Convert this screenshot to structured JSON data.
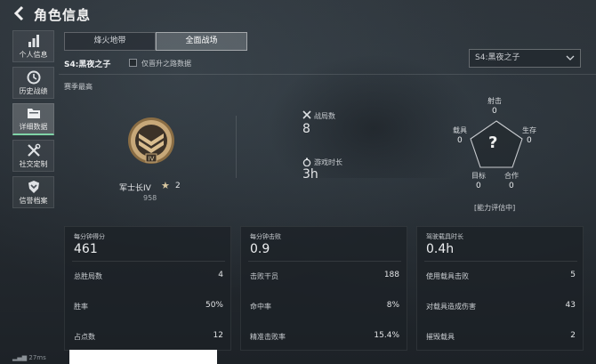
{
  "header": {
    "title": "角色信息"
  },
  "sidebar": {
    "items": [
      {
        "label": "个人信息",
        "icon": "bar-chart-icon"
      },
      {
        "label": "历史战绩",
        "icon": "clock-icon"
      },
      {
        "label": "详细数据",
        "icon": "folder-icon",
        "active": true
      },
      {
        "label": "社交定制",
        "icon": "tools-icon"
      },
      {
        "label": "信誉档案",
        "icon": "shield-icon"
      }
    ]
  },
  "tabs": [
    {
      "label": "烽火地带",
      "active": false
    },
    {
      "label": "全面战场",
      "active": true
    }
  ],
  "season": {
    "label": "S4:黑夜之子",
    "checkbox_label": "仅晋升之路数据",
    "checkbox_checked": false,
    "select_value": "S4:黑夜之子",
    "best_label": "赛季最高"
  },
  "rank": {
    "name": "军士长IV",
    "stars": "2",
    "points": "958",
    "badge_numeral": "IV",
    "badge_color": "#b89a6a"
  },
  "mid_stats": [
    {
      "label": "战局数",
      "value": "8",
      "icon": "crossed-swords-icon"
    },
    {
      "label": "游戏时长",
      "value": "3h",
      "icon": "stopwatch-icon"
    }
  ],
  "radar": {
    "center_glyph": "?",
    "axes": [
      {
        "label": "射击",
        "value": "0"
      },
      {
        "label": "生存",
        "value": "0"
      },
      {
        "label": "合作",
        "value": "0"
      },
      {
        "label": "目标",
        "value": "0"
      },
      {
        "label": "载具",
        "value": "0"
      }
    ],
    "note": "[能力评估中]"
  },
  "cards": [
    {
      "head_label": "每分钟得分",
      "head_value": "461",
      "rows": [
        {
          "label": "总胜局数",
          "value": "4"
        },
        {
          "label": "胜率",
          "value": "50%"
        },
        {
          "label": "占点数",
          "value": "12"
        }
      ]
    },
    {
      "head_label": "每分钟击败",
      "head_value": "0.9",
      "rows": [
        {
          "label": "击败干员",
          "value": "188"
        },
        {
          "label": "命中率",
          "value": "8%"
        },
        {
          "label": "精准击败率",
          "value": "15.4%"
        }
      ]
    },
    {
      "head_label": "驾驶载具时长",
      "head_value": "0.4h",
      "rows": [
        {
          "label": "使用载具击败",
          "value": "5"
        },
        {
          "label": "对载具造成伤害",
          "value": "43"
        },
        {
          "label": "摧毁载具",
          "value": "2"
        }
      ]
    }
  ],
  "status": {
    "ping": "27ms"
  },
  "colors": {
    "accent": "#7fd3a7",
    "badge": "#b89a6a"
  }
}
